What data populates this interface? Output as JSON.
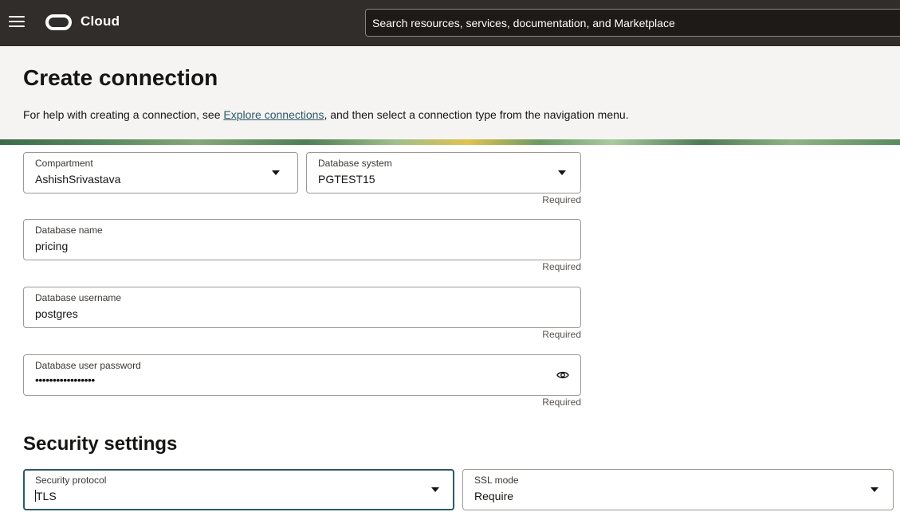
{
  "topbar": {
    "brand": "Cloud",
    "search_placeholder": "Search resources, services, documentation, and Marketplace"
  },
  "header": {
    "title": "Create connection",
    "help_prefix": "For help with creating a connection, see ",
    "help_link": "Explore connections",
    "help_suffix": ", and then select a connection type from the navigation menu."
  },
  "form": {
    "compartment": {
      "label": "Compartment",
      "value": "AshishSrivastava"
    },
    "database_system": {
      "label": "Database system",
      "value": "PGTEST15",
      "hint": "Required"
    },
    "database_name": {
      "label": "Database name",
      "value": "pricing",
      "hint": "Required"
    },
    "database_username": {
      "label": "Database username",
      "value": "postgres",
      "hint": "Required"
    },
    "database_password": {
      "label": "Database user password",
      "value": "•••••••••••••••••",
      "hint": "Required"
    }
  },
  "security": {
    "title": "Security settings",
    "protocol": {
      "label": "Security protocol",
      "value": "TLS"
    },
    "ssl_mode": {
      "label": "SSL mode",
      "value": "Require"
    }
  },
  "icons": {
    "menu": "hamburger-icon",
    "logo": "oracle-logo-icon",
    "dropdown": "chevron-down-icon",
    "reveal": "eye-icon"
  },
  "colors": {
    "topbar": "#312d2a",
    "header_bg": "#f5f4f2",
    "link": "#2c5967",
    "focus_border": "#2c5967"
  }
}
